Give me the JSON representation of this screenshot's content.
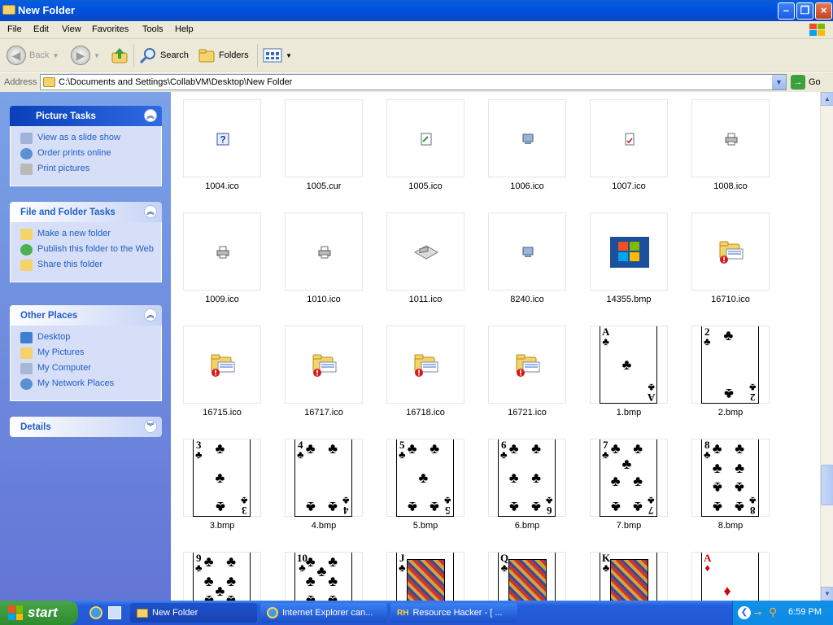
{
  "window": {
    "title": "New Folder"
  },
  "menu": [
    "File",
    "Edit",
    "View",
    "Favorites",
    "Tools",
    "Help"
  ],
  "toolbar": {
    "back": "Back",
    "search": "Search",
    "folders": "Folders"
  },
  "address": {
    "label": "Address",
    "path": "C:\\Documents and Settings\\CollabVM\\Desktop\\New Folder",
    "go": "Go"
  },
  "sidebar": {
    "picture_tasks": {
      "title": "Picture Tasks",
      "items": [
        "View as a slide show",
        "Order prints online",
        "Print pictures"
      ]
    },
    "file_tasks": {
      "title": "File and Folder Tasks",
      "items": [
        "Make a new folder",
        "Publish this folder to the Web",
        "Share this folder"
      ]
    },
    "other_places": {
      "title": "Other Places",
      "items": [
        "Desktop",
        "My Pictures",
        "My Computer",
        "My Network Places"
      ]
    },
    "details": {
      "title": "Details"
    }
  },
  "files": [
    {
      "name": "1004.ico",
      "kind": "help-icon"
    },
    {
      "name": "1005.cur",
      "kind": "blank"
    },
    {
      "name": "1005.ico",
      "kind": "doc-icon"
    },
    {
      "name": "1006.ico",
      "kind": "computer-icon"
    },
    {
      "name": "1007.ico",
      "kind": "doc-red-icon"
    },
    {
      "name": "1008.ico",
      "kind": "printer-icon"
    },
    {
      "name": "1009.ico",
      "kind": "printer-icon"
    },
    {
      "name": "1010.ico",
      "kind": "printer-icon"
    },
    {
      "name": "1011.ico",
      "kind": "fax-icon"
    },
    {
      "name": "8240.ico",
      "kind": "computer-icon"
    },
    {
      "name": "14355.bmp",
      "kind": "windows-logo"
    },
    {
      "name": "16710.ico",
      "kind": "folder-error-icon"
    },
    {
      "name": "16715.ico",
      "kind": "folder-error-icon"
    },
    {
      "name": "16717.ico",
      "kind": "folder-error-icon"
    },
    {
      "name": "16718.ico",
      "kind": "folder-error-icon"
    },
    {
      "name": "16721.ico",
      "kind": "folder-error-icon"
    },
    {
      "name": "1.bmp",
      "kind": "card",
      "rank": "A",
      "suit": "♣",
      "color": "#000"
    },
    {
      "name": "2.bmp",
      "kind": "card",
      "rank": "2",
      "suit": "♣",
      "color": "#000"
    },
    {
      "name": "3.bmp",
      "kind": "card",
      "rank": "3",
      "suit": "♣",
      "color": "#000"
    },
    {
      "name": "4.bmp",
      "kind": "card",
      "rank": "4",
      "suit": "♣",
      "color": "#000"
    },
    {
      "name": "5.bmp",
      "kind": "card",
      "rank": "5",
      "suit": "♣",
      "color": "#000"
    },
    {
      "name": "6.bmp",
      "kind": "card",
      "rank": "6",
      "suit": "♣",
      "color": "#000"
    },
    {
      "name": "7.bmp",
      "kind": "card",
      "rank": "7",
      "suit": "♣",
      "color": "#000"
    },
    {
      "name": "8.bmp",
      "kind": "card",
      "rank": "8",
      "suit": "♣",
      "color": "#000"
    },
    {
      "name": "",
      "kind": "card",
      "rank": "9",
      "suit": "♣",
      "color": "#000"
    },
    {
      "name": "",
      "kind": "card",
      "rank": "10",
      "suit": "♣",
      "color": "#000"
    },
    {
      "name": "",
      "kind": "card",
      "rank": "J",
      "suit": "♣",
      "color": "#000"
    },
    {
      "name": "",
      "kind": "card",
      "rank": "Q",
      "suit": "♣",
      "color": "#000"
    },
    {
      "name": "",
      "kind": "card",
      "rank": "K",
      "suit": "♣",
      "color": "#000"
    },
    {
      "name": "",
      "kind": "card",
      "rank": "A",
      "suit": "♦",
      "color": "#d40000"
    }
  ],
  "taskbar": {
    "start": "start",
    "items": [
      "New Folder",
      "Internet Explorer can...",
      "Resource Hacker - [ ..."
    ],
    "clock": "6:59 PM"
  },
  "colors": {
    "titlebar": "#0053e1",
    "sidebar": "#7ba2e7",
    "link": "#215dc6",
    "taskbar": "#245edb",
    "start": "#2e8b2e"
  }
}
